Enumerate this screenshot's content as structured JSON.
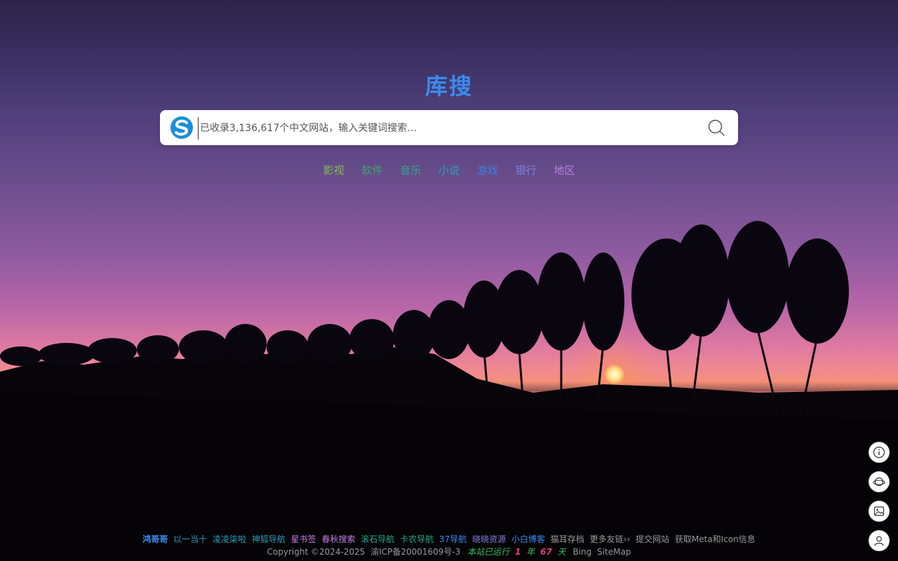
{
  "site": {
    "title": "库搜"
  },
  "search": {
    "placeholder": "已收录3,136,617个中文网站，输入关键词搜索…",
    "value": ""
  },
  "categories": [
    {
      "label": "影视",
      "color": "#7fbf4a"
    },
    {
      "label": "软件",
      "color": "#3aa86a"
    },
    {
      "label": "音乐",
      "color": "#2fa88a"
    },
    {
      "label": "小说",
      "color": "#2a9fc0"
    },
    {
      "label": "游戏",
      "color": "#3b7fe0"
    },
    {
      "label": "银行",
      "color": "#7f7fe0"
    },
    {
      "label": "地区",
      "color": "#b77fe0"
    }
  ],
  "side_buttons": [
    {
      "icon": "info-icon"
    },
    {
      "icon": "planet-icon"
    },
    {
      "icon": "image-icon"
    },
    {
      "icon": "user-icon"
    }
  ],
  "footer": {
    "links": [
      {
        "label": "鸿哥哥",
        "color": "#3b8bf0"
      },
      {
        "label": "以一当十",
        "color": "#2aa0c0"
      },
      {
        "label": "凌凌柒啦",
        "color": "#2aa0c0"
      },
      {
        "label": "神狐导航",
        "color": "#2aa0c0"
      },
      {
        "label": "星书签",
        "color": "#c07fe0"
      },
      {
        "label": "春秋搜索",
        "color": "#c07fe0"
      },
      {
        "label": "滚石导航",
        "color": "#2aa88a"
      },
      {
        "label": "卡农导航",
        "color": "#2aa88a"
      },
      {
        "label": "37导航",
        "color": "#3b8bf0"
      },
      {
        "label": "晓晓资源",
        "color": "#7f7fe0"
      },
      {
        "label": "小白博客",
        "color": "#3b8bf0"
      },
      {
        "label": "猫耳存档",
        "color": "#9a9a9a"
      },
      {
        "label": "更多友链››",
        "color": "#9a9a9a"
      },
      {
        "label": "提交网站",
        "color": "#9a9a9a"
      },
      {
        "label": "获取Meta和Icon信息",
        "color": "#9a9a9a"
      }
    ],
    "copyright": "Copyright ©2024-2025",
    "icp": "渝ICP备20001609号-3",
    "runtime_prefix": "本站已运行",
    "runtime_years": "1",
    "runtime_year_unit": "年",
    "runtime_days": "67",
    "runtime_day_unit": "天",
    "bing": "Bing",
    "sitemap": "SiteMap"
  },
  "colors": {
    "title": "#3b8bf0",
    "logo": "#1a8fd8"
  }
}
